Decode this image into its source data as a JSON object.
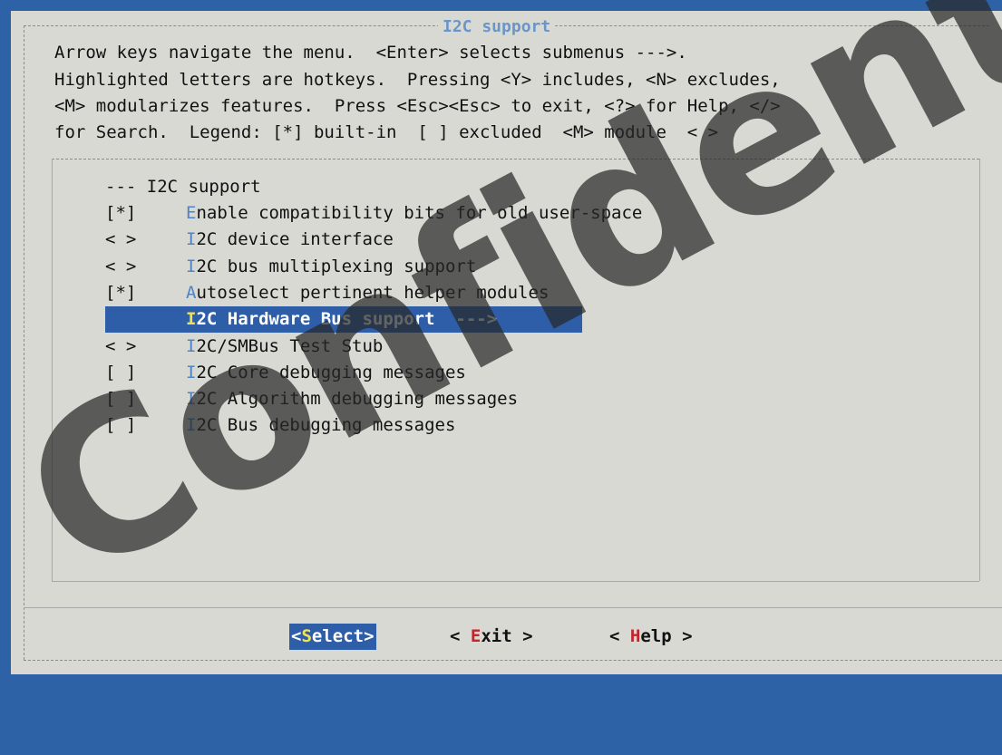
{
  "dialog": {
    "title": "I2C support",
    "help_lines": [
      "Arrow keys navigate the menu.  <Enter> selects submenus --->.",
      "Highlighted letters are hotkeys.  Pressing <Y> includes, <N> excludes,",
      "<M> modularizes features.  Press <Esc><Esc> to exit, <?> for Help, </>",
      "for Search.  Legend: [*] built-in  [ ] excluded  <M> module  < >"
    ]
  },
  "menu": {
    "header": "--- I2C support",
    "items": [
      {
        "prefix": "[*]",
        "hotkey": "E",
        "rest": "nable compatibility bits for old user-space"
      },
      {
        "prefix": "< >",
        "hotkey": "I",
        "rest": "2C device interface"
      },
      {
        "prefix": "< >",
        "hotkey": "I",
        "rest": "2C bus multiplexing support"
      },
      {
        "prefix": "[*]",
        "hotkey": "A",
        "rest": "utoselect pertinent helper modules"
      },
      {
        "prefix": "",
        "hotkey": "I",
        "rest": "2C Hardware Bus support  --->"
      },
      {
        "prefix": "< >",
        "hotkey": "I",
        "rest": "2C/SMBus Test Stub"
      },
      {
        "prefix": "[ ]",
        "hotkey": "I",
        "rest": "2C Core debugging messages"
      },
      {
        "prefix": "[ ]",
        "hotkey": "I",
        "rest": "2C Algorithm debugging messages"
      },
      {
        "prefix": "[ ]",
        "hotkey": "I",
        "rest": "2C Bus debugging messages"
      }
    ],
    "selected_index": 4
  },
  "buttons": {
    "select": {
      "open": "<",
      "hotkey": "S",
      "rest": "elect",
      "close": ">"
    },
    "exit": {
      "open": "< ",
      "hotkey": "E",
      "rest": "xit",
      "close": " >"
    },
    "help": {
      "open": "< ",
      "hotkey": "H",
      "rest": "elp",
      "close": " >"
    }
  },
  "watermark": "Confidential",
  "colors": {
    "background": "#2e62a7",
    "dialog": "#d9d9d4",
    "highlight": "#2e5ea8",
    "hotkey": "#4f83c5",
    "selected_hotkey": "#f0e252",
    "button_hotkey": "#c3242c"
  }
}
